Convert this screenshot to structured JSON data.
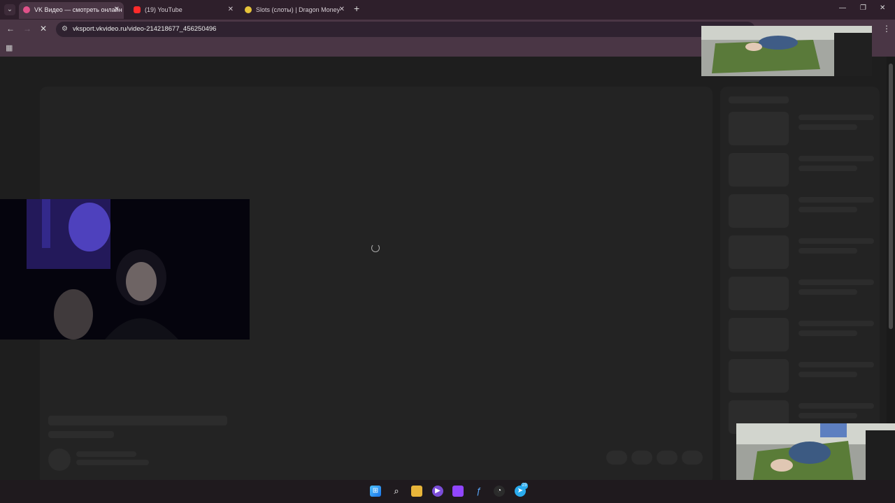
{
  "tabs": [
    {
      "title": "VK Видео — смотреть онлайн",
      "active": true,
      "icon": "vk-icon",
      "color": "#e0528a"
    },
    {
      "title": "(19) YouTube",
      "active": false,
      "icon": "youtube-icon",
      "color": "#ff2b2b"
    },
    {
      "title": "Slots (слоты) | Dragon Money",
      "active": false,
      "icon": "dragon-money-icon",
      "color": "#e6c33a"
    }
  ],
  "address_bar": {
    "url": "vksport.vkvideo.ru/video-214218677_456250496"
  },
  "taskbar": {
    "icons": [
      "windows-start-icon",
      "search-icon",
      "file-explorer-icon",
      "media-app-icon",
      "twitch-icon",
      "app-icon",
      "steam-icon",
      "telegram-icon"
    ],
    "badge": "23"
  }
}
